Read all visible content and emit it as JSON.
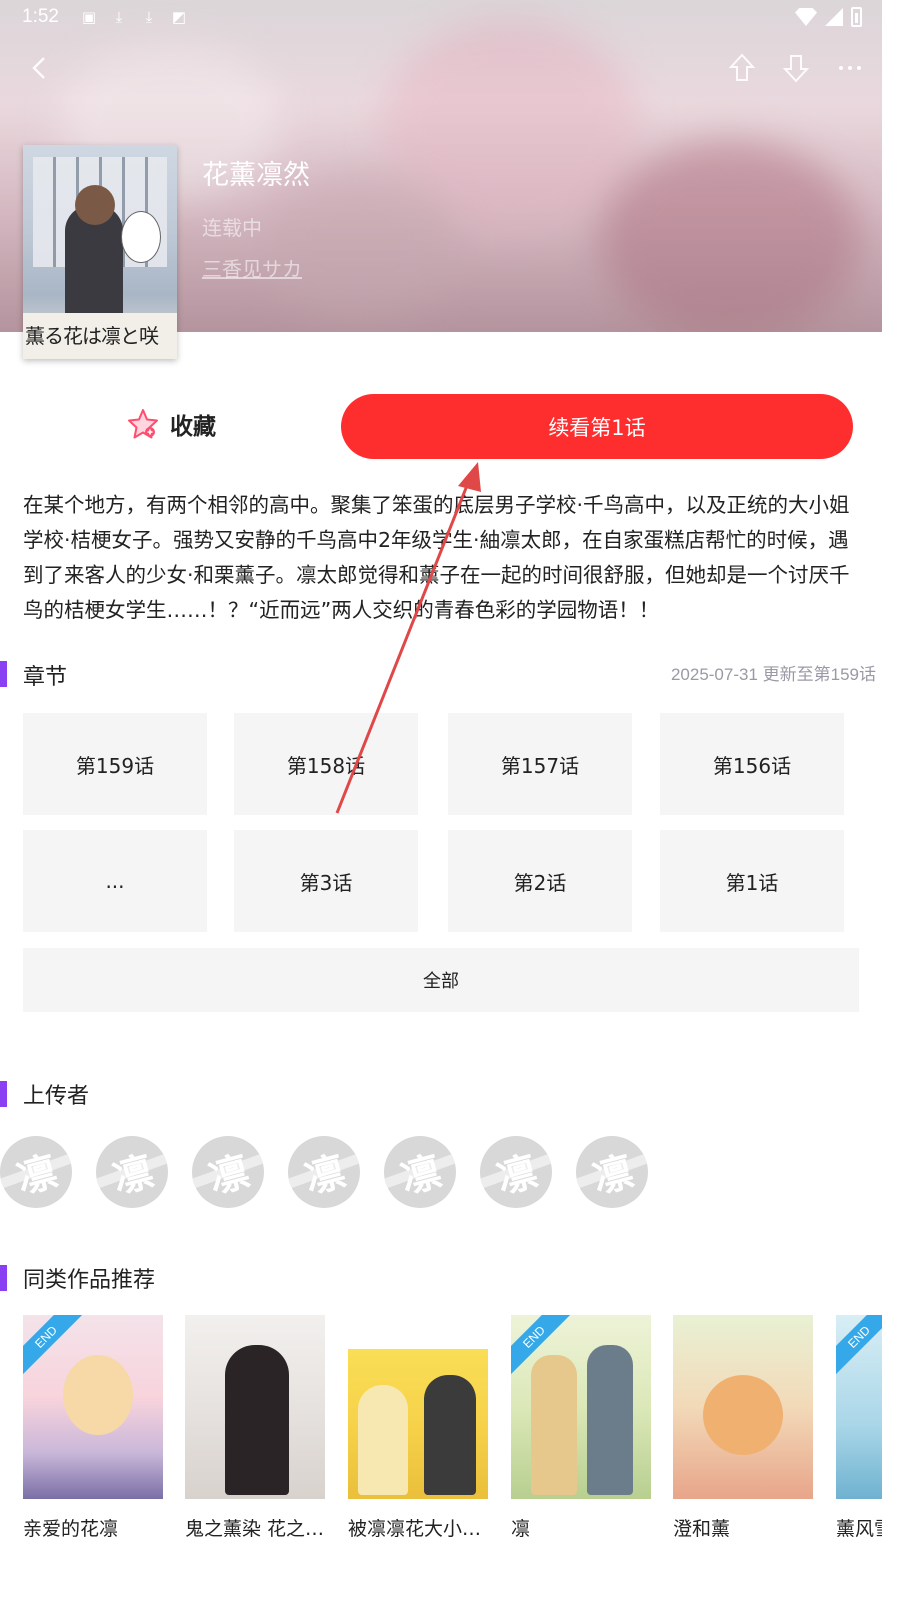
{
  "status_bar": {
    "time": "1:52"
  },
  "manga": {
    "title": "花薰凛然",
    "status": "连载中",
    "author": "三香见サカ",
    "cover_title": "薫る花は凛と咲"
  },
  "actions": {
    "favorite_label": "收藏",
    "continue_label": "续看第1话"
  },
  "description": "在某个地方，有两个相邻的高中。聚集了笨蛋的底层男子学校·千鸟高中，以及正统的大小姐学校·桔梗女子。强势又安静的千鸟高中2年级学生·紬凛太郎，在自家蛋糕店帮忙的时候，遇到了来客人的少女·和栗薰子。凛太郎觉得和薰子在一起的时间很舒服，但她却是一个讨厌千鸟的桔梗女学生……！？“近而远”两人交织的青春色彩的学园物语！！",
  "chapters": {
    "section_title": "章节",
    "update_info": "2025-07-31 更新至第159话",
    "row1": [
      "第159话",
      "第158话",
      "第157话",
      "第156话"
    ],
    "row2": [
      "...",
      "第3话",
      "第2话",
      "第1话"
    ],
    "all_label": "全部"
  },
  "uploaders": {
    "section_title": "上传者",
    "avatar_char": "凛"
  },
  "recommendations": {
    "section_title": "同类作品推荐",
    "end_tag": "END",
    "items": [
      "亲爱的花凛",
      "鬼之薰染 花之…",
      "被凛凛花大小…",
      "凛",
      "澄和薰",
      "薰风雪"
    ]
  },
  "colors": {
    "accent_red": "#ff2e2e",
    "section_bar": "#8b3ff2",
    "chip_bg": "#f5f5f5",
    "annotation_arrow": "#e04848"
  }
}
